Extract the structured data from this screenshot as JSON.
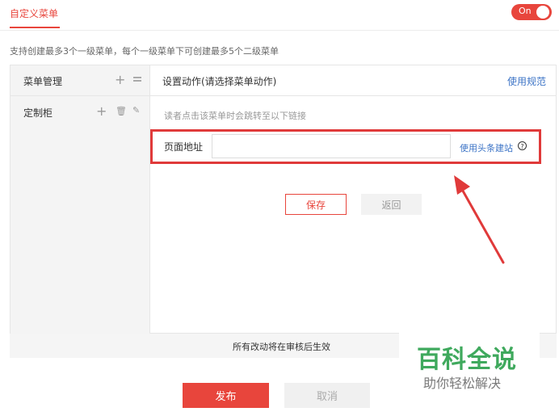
{
  "header": {
    "tab_title": "自定义菜单",
    "toggle_label": "On"
  },
  "hint": "支持创建最多3个一级菜单，每个一级菜单下可创建最多5个二级菜单",
  "sidebar": {
    "title": "菜单管理",
    "items": [
      {
        "label": "定制柜"
      }
    ]
  },
  "action_panel": {
    "title": "设置动作(请选择菜单动作)",
    "rules_link": "使用规范",
    "redirect_note": "读者点击该菜单时会跳转至以下链接",
    "url_label": "页面地址",
    "url_value": "",
    "site_link": "使用头条建站",
    "help_icon": "?"
  },
  "buttons": {
    "save": "保存",
    "back": "返回",
    "publish": "发布",
    "cancel": "取消"
  },
  "notice": "所有改动将在审核后生效",
  "watermark": {
    "main": "百科全说",
    "sub": "助你轻松解决"
  },
  "colors": {
    "accent": "#e8453c",
    "link": "#3d74c6",
    "highlight": "#e03a3a",
    "watermark": "#3fa95d"
  }
}
